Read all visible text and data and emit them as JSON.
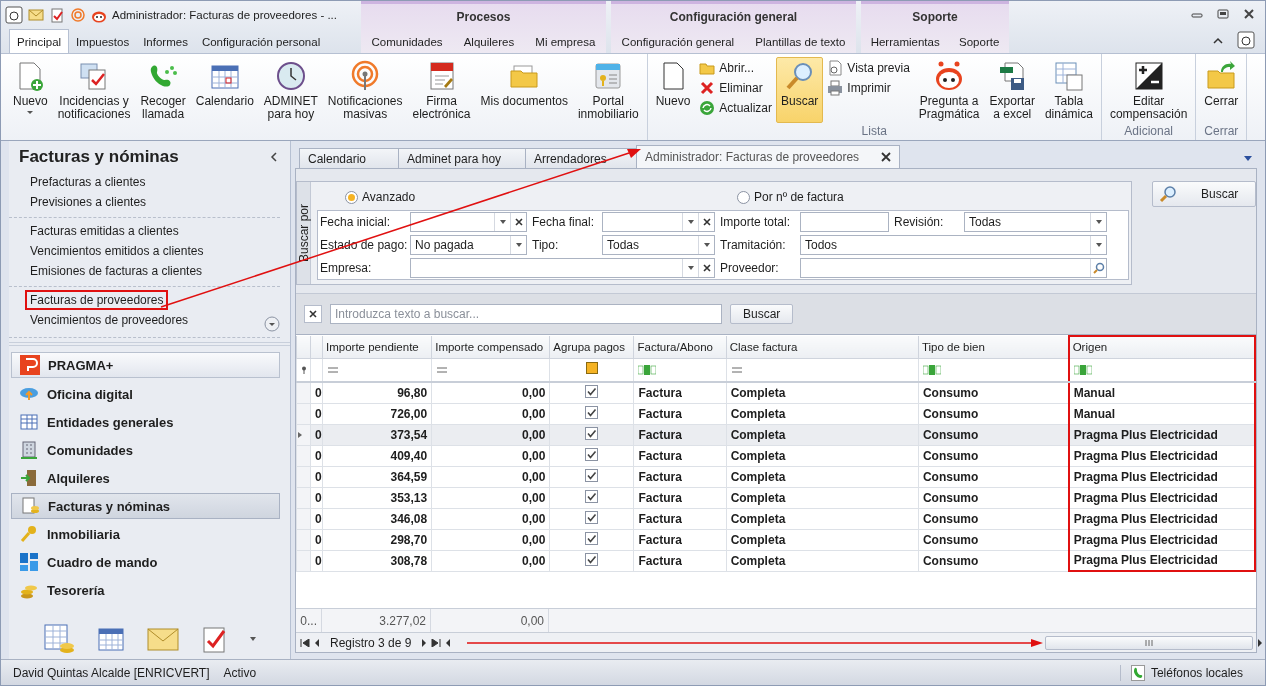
{
  "window": {
    "title": "Administrador: Facturas de proveedores - ..."
  },
  "ribbon_tabs": [
    {
      "label": "Principal",
      "selected": true
    },
    {
      "label": "Impuestos",
      "selected": false
    },
    {
      "label": "Informes",
      "selected": false
    },
    {
      "label": "Configuración personal",
      "selected": false
    }
  ],
  "context_groups": [
    {
      "label": "Procesos",
      "tabs": [
        {
          "label": "Comunidades",
          "selected": false
        },
        {
          "label": "Alquileres",
          "selected": false
        },
        {
          "label": "Mi empresa",
          "selected": false
        }
      ]
    },
    {
      "label": "Configuración general",
      "tabs": [
        {
          "label": "Configuración general",
          "selected": false
        },
        {
          "label": "Plantillas de texto",
          "selected": false
        }
      ]
    },
    {
      "label": "Soporte",
      "tabs": [
        {
          "label": "Herramientas",
          "selected": false
        },
        {
          "label": "Soporte",
          "selected": false
        }
      ]
    }
  ],
  "ribbon_groups": [
    {
      "items": [
        {
          "kind": "large",
          "label": "Nuevo",
          "dropdown": true,
          "pressed": false
        },
        {
          "kind": "large",
          "label": "Incidencias y\nnotificaciones",
          "pressed": false
        },
        {
          "kind": "large",
          "label": "Recoger\nllamada",
          "pressed": false
        },
        {
          "kind": "large",
          "label": "Calendario",
          "pressed": false
        },
        {
          "kind": "large",
          "label": "ADMINET\npara hoy",
          "pressed": false
        },
        {
          "kind": "large",
          "label": "Notificaciones\nmasivas",
          "pressed": false
        },
        {
          "kind": "large",
          "label": "Firma\nelectrónica",
          "pressed": false
        },
        {
          "kind": "large",
          "label": "Mis documentos",
          "pressed": false
        },
        {
          "kind": "large",
          "label": "Portal\ninmobiliario",
          "pressed": false
        }
      ]
    },
    {
      "label": "Lista",
      "items": [
        {
          "kind": "large",
          "label": "Nuevo",
          "pressed": false
        },
        {
          "kind": "stack",
          "items": [
            {
              "label": "Abrir..."
            },
            {
              "label": "Eliminar"
            },
            {
              "label": "Actualizar"
            }
          ]
        },
        {
          "kind": "large",
          "label": "Buscar",
          "pressed": true
        },
        {
          "kind": "stack",
          "items": [
            {
              "label": "Vista previa"
            },
            {
              "label": "Imprimir"
            }
          ]
        },
        {
          "kind": "large",
          "label": "Pregunta a\nPragmática",
          "pressed": false
        },
        {
          "kind": "large",
          "label": "Exportar\na excel",
          "pressed": false
        },
        {
          "kind": "large",
          "label": "Tabla\ndinámica",
          "pressed": false
        }
      ]
    },
    {
      "label": "Adicional",
      "items": [
        {
          "kind": "large",
          "label": "Editar\ncompensación",
          "pressed": false
        }
      ]
    },
    {
      "label": "Cerrar",
      "items": [
        {
          "kind": "large",
          "label": "Cerrar",
          "pressed": false
        }
      ]
    }
  ],
  "sidebar": {
    "title": "Facturas y nóminas",
    "link_sections": [
      [
        {
          "label": "Prefacturas a clientes",
          "highlighted": false
        },
        {
          "label": "Previsiones a clientes",
          "highlighted": false
        }
      ],
      [
        {
          "label": "Facturas emitidas a clientes",
          "highlighted": false
        },
        {
          "label": "Vencimientos emitidos a clientes",
          "highlighted": false
        },
        {
          "label": "Emisiones de facturas a clientes",
          "highlighted": false
        }
      ],
      [
        {
          "label": "Facturas de proveedores",
          "highlighted": true
        },
        {
          "label": "Vencimientos de proveedores",
          "highlighted": false
        }
      ]
    ],
    "modules": [
      {
        "label": "PRAGMA+",
        "kind": "banner",
        "selected": false
      },
      {
        "label": "Oficina digital",
        "kind": "module",
        "selected": false
      },
      {
        "label": "Entidades generales",
        "kind": "module",
        "selected": false
      },
      {
        "label": "Comunidades",
        "kind": "module",
        "selected": false
      },
      {
        "label": "Alquileres",
        "kind": "module",
        "selected": false
      },
      {
        "label": "Facturas y nóminas",
        "kind": "module",
        "selected": true
      },
      {
        "label": "Inmobiliaria",
        "kind": "module",
        "selected": false
      },
      {
        "label": "Cuadro de mando",
        "kind": "module",
        "selected": false
      },
      {
        "label": "Tesorería",
        "kind": "module",
        "selected": false
      }
    ]
  },
  "document_tabs": [
    {
      "label": "Calendario",
      "selected": false
    },
    {
      "label": "Adminet para hoy",
      "selected": false
    },
    {
      "label": "Arrendadores",
      "selected": false
    },
    {
      "label": "Administrador: Facturas de proveedores",
      "selected": true,
      "closable": true
    }
  ],
  "search_panel": {
    "title": "Buscar por",
    "modes": [
      {
        "label": "Avanzado",
        "selected": true
      },
      {
        "label": "Por nº de factura",
        "selected": false
      }
    ],
    "lines": [
      {
        "fields": [
          {
            "label": "Fecha inicial:",
            "kind": "combo",
            "clearable": true
          },
          {
            "label": "Fecha final:",
            "kind": "combo",
            "clearable": true
          },
          {
            "label": "Importe total:",
            "kind": "text"
          },
          {
            "label": "Revisión:",
            "kind": "combo",
            "value": "Todas"
          }
        ]
      },
      {
        "fields": [
          {
            "label": "Estado de pago:",
            "kind": "combo",
            "value": "No pagada"
          },
          {
            "label": "Tipo:",
            "kind": "combo",
            "value": "Todas"
          },
          {
            "label": "Tramitación:",
            "kind": "combo",
            "value": "Todos"
          }
        ]
      },
      {
        "fields": [
          {
            "label": "Empresa:",
            "kind": "combo",
            "clearable": true
          },
          {
            "label": "Proveedor:",
            "kind": "search"
          }
        ]
      }
    ],
    "button": "Buscar"
  },
  "grid_search": {
    "placeholder": "Introduzca texto a buscar...",
    "button": "Buscar"
  },
  "table": {
    "columns": [
      {
        "label": "Importe pendiente",
        "kind": "equals",
        "highlighted": false
      },
      {
        "label": "Importe compensado",
        "kind": "equals",
        "highlighted": false
      },
      {
        "label": "Agrupa pagos",
        "kind": "check",
        "highlighted": false
      },
      {
        "label": "Factura/Abono",
        "kind": "text",
        "highlighted": false
      },
      {
        "label": "Clase factura",
        "kind": "equals",
        "highlighted": false
      },
      {
        "label": "Tipo de bien",
        "kind": "text",
        "highlighted": false
      },
      {
        "label": "Origen",
        "kind": "text",
        "highlighted": true
      }
    ],
    "rows": [
      {
        "selected": false,
        "column_1": "0",
        "cells": [
          "96,80",
          "0,00",
          true,
          "Factura",
          "Completa",
          "Consumo",
          "Manual"
        ]
      },
      {
        "selected": false,
        "column_1": "0",
        "cells": [
          "726,00",
          "0,00",
          true,
          "Factura",
          "Completa",
          "Consumo",
          "Manual"
        ]
      },
      {
        "selected": true,
        "column_1": "0",
        "cells": [
          "373,54",
          "0,00",
          true,
          "Factura",
          "Completa",
          "Consumo",
          "Pragma Plus Electricidad"
        ]
      },
      {
        "selected": false,
        "column_1": "0",
        "cells": [
          "409,40",
          "0,00",
          true,
          "Factura",
          "Completa",
          "Consumo",
          "Pragma Plus Electricidad"
        ]
      },
      {
        "selected": false,
        "column_1": "0",
        "cells": [
          "364,59",
          "0,00",
          true,
          "Factura",
          "Completa",
          "Consumo",
          "Pragma Plus Electricidad"
        ]
      },
      {
        "selected": false,
        "column_1": "0",
        "cells": [
          "353,13",
          "0,00",
          true,
          "Factura",
          "Completa",
          "Consumo",
          "Pragma Plus Electricidad"
        ]
      },
      {
        "selected": false,
        "column_1": "0",
        "cells": [
          "346,08",
          "0,00",
          true,
          "Factura",
          "Completa",
          "Consumo",
          "Pragma Plus Electricidad"
        ]
      },
      {
        "selected": false,
        "column_1": "0",
        "cells": [
          "298,70",
          "0,00",
          true,
          "Factura",
          "Completa",
          "Consumo",
          "Pragma Plus Electricidad"
        ]
      },
      {
        "selected": false,
        "column_1": "0",
        "cells": [
          "308,78",
          "0,00",
          true,
          "Factura",
          "Completa",
          "Consumo",
          "Pragma Plus Electricidad"
        ]
      }
    ],
    "footer": {
      "column_1": "0...",
      "totals": [
        "3.277,02",
        "0,00"
      ]
    },
    "navigator": "Registro 3 de 9"
  },
  "status_bar": {
    "user": "David Quintas Alcalde [ENRICVERT]",
    "state": "Activo",
    "phones": "Teléfonos locales"
  }
}
